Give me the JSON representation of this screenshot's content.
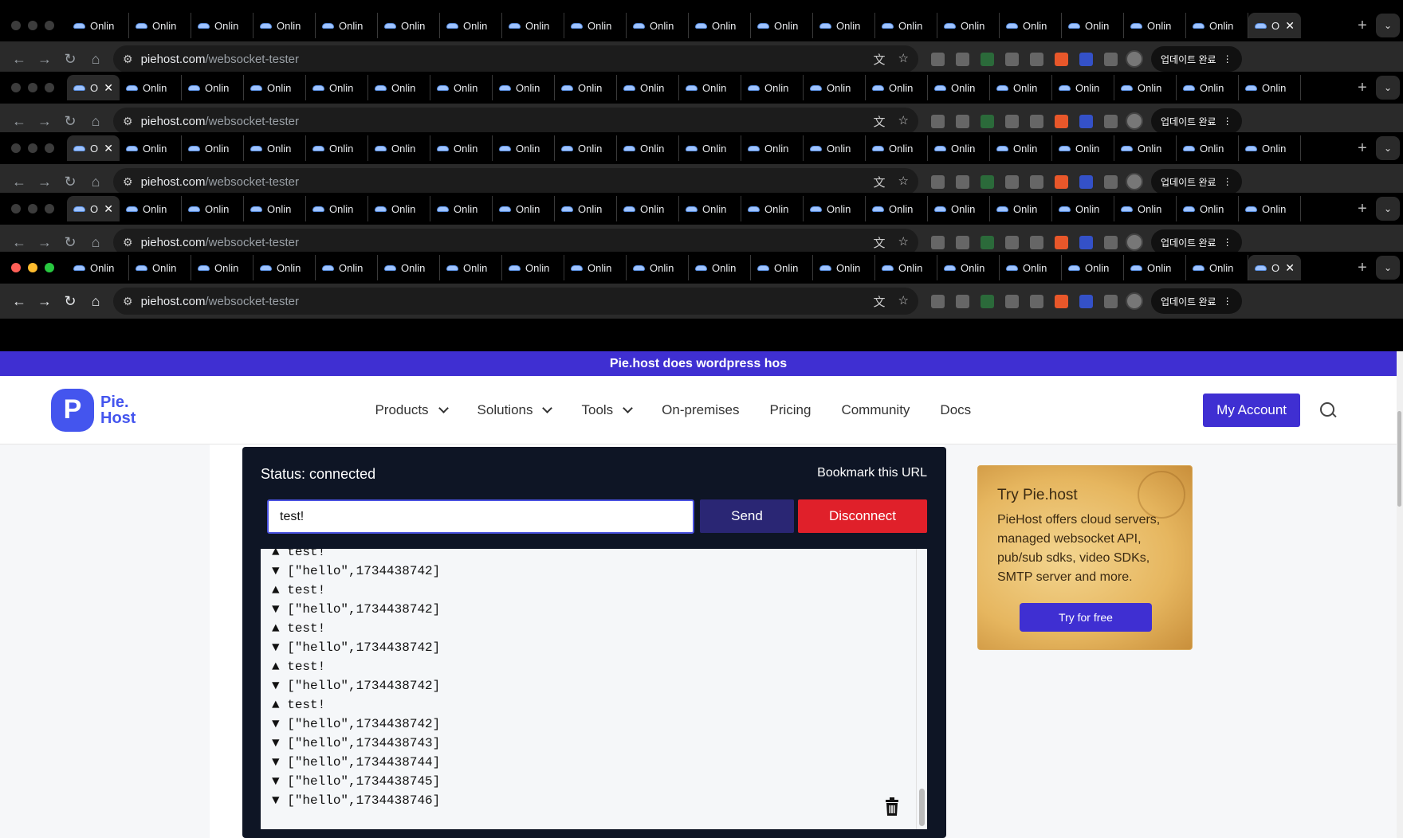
{
  "browser": {
    "tab_label": "Onlin",
    "active_tab_label": "O",
    "url_domain": "piehost.com",
    "url_path": "/websocket-tester",
    "update_label": "업데이트 완료"
  },
  "banner": {
    "text": "Pie.host does wordpress hos"
  },
  "header": {
    "logo_mark": "P",
    "logo_line1": "Pie.",
    "logo_line2": "Host",
    "nav": [
      {
        "label": "Products",
        "dropdown": true
      },
      {
        "label": "Solutions",
        "dropdown": true
      },
      {
        "label": "Tools",
        "dropdown": true
      },
      {
        "label": "On-premises",
        "dropdown": false
      },
      {
        "label": "Pricing",
        "dropdown": false
      },
      {
        "label": "Community",
        "dropdown": false
      },
      {
        "label": "Docs",
        "dropdown": false
      }
    ],
    "account_button": "My Account"
  },
  "tester": {
    "status": "Status: connected",
    "bookmark": "Bookmark this URL",
    "input_value": "test!",
    "send_label": "Send",
    "disconnect_label": "Disconnect",
    "log": [
      {
        "dir": "▲",
        "text": "test!"
      },
      {
        "dir": "▼",
        "text": "[\"hello\",1734438742]"
      },
      {
        "dir": "▲",
        "text": "test!"
      },
      {
        "dir": "▼",
        "text": "[\"hello\",1734438742]"
      },
      {
        "dir": "▲",
        "text": "test!"
      },
      {
        "dir": "▼",
        "text": "[\"hello\",1734438742]"
      },
      {
        "dir": "▲",
        "text": "test!"
      },
      {
        "dir": "▼",
        "text": "[\"hello\",1734438742]"
      },
      {
        "dir": "▲",
        "text": "test!"
      },
      {
        "dir": "▼",
        "text": "[\"hello\",1734438742]"
      },
      {
        "dir": "▼",
        "text": "[\"hello\",1734438743]"
      },
      {
        "dir": "▼",
        "text": "[\"hello\",1734438744]"
      },
      {
        "dir": "▼",
        "text": "[\"hello\",1734438745]"
      },
      {
        "dir": "▼",
        "text": "[\"hello\",1734438746]"
      }
    ]
  },
  "promo": {
    "title": "Try Pie.host",
    "text": "PieHost offers cloud servers, managed websocket API, pub/sub sdks, video SDKs, SMTP server and more.",
    "button": "Try for free"
  },
  "colors": {
    "brand": "#3f2fd2",
    "danger": "#e0202a",
    "tester_bg": "#0e1525"
  }
}
